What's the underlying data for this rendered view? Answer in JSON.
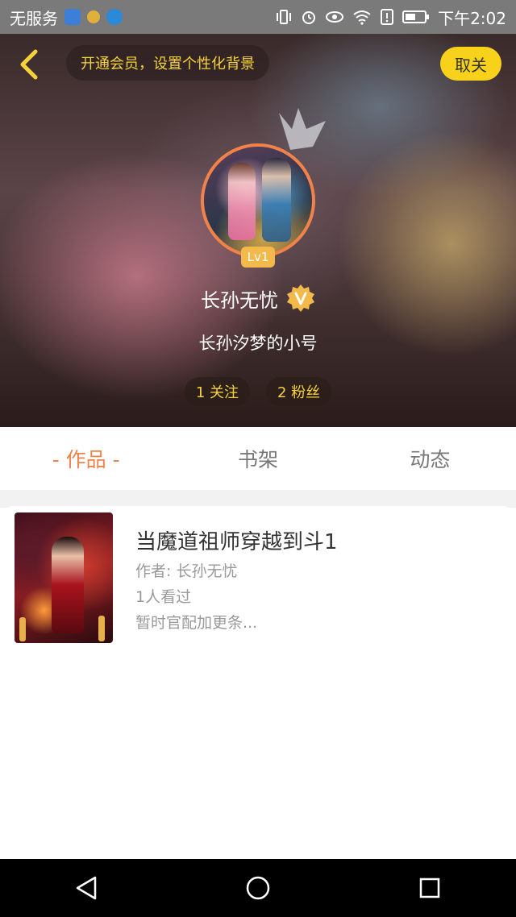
{
  "status_bar": {
    "carrier": "无服务",
    "time": "下午2:02"
  },
  "header": {
    "vip_prompt": "开通会员，设置个性化背景",
    "cancel_label": "取关",
    "level": "Lv1",
    "username": "长孙无忧",
    "signature": "长孙汐梦的小号",
    "following": "1 关注",
    "followers": "2 粉丝"
  },
  "tabs": [
    {
      "label": "- 作品 -",
      "active": true
    },
    {
      "label": "书架",
      "active": false
    },
    {
      "label": "动态",
      "active": false
    }
  ],
  "works": [
    {
      "title": "当魔道祖师穿越到斗1",
      "author": "作者: 长孙无忧",
      "views": "1人看过",
      "desc": "暂时官配加更条..."
    }
  ],
  "colors": {
    "accent": "#f0824a",
    "yellow": "#f8d21a",
    "badge": "#f3b94a"
  },
  "icons": {
    "back": "chevron-left-icon",
    "crown": "crown-icon",
    "verified": "verified-v-icon",
    "nav_back": "triangle-back-icon",
    "nav_home": "circle-home-icon",
    "nav_recent": "square-recent-icon"
  }
}
